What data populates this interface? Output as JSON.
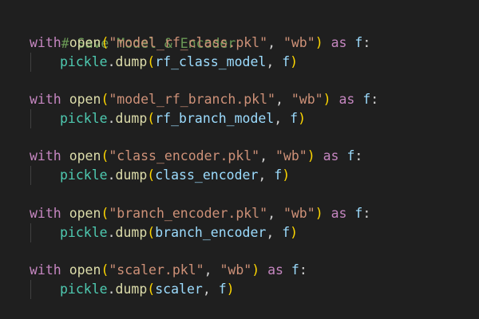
{
  "colors": {
    "background": "#1f1f1f",
    "comment": "#6a9955",
    "keyword": "#c586c0",
    "function": "#dcdcaa",
    "string": "#ce9178",
    "variable": "#9cdcfe",
    "module": "#4ec9b0",
    "bracket_level_1": "#ffd700",
    "bracket_level_2": "#da70d6"
  },
  "comment": "# Save Model & Encoder",
  "blocks": [
    {
      "with_kw": "with",
      "open_fn": "open",
      "filename": "\"model_rf_class.pkl\"",
      "mode": "\"wb\"",
      "as_kw": "as",
      "alias": "f",
      "module": "pickle",
      "method": "dump",
      "object": "rf_class_model",
      "target": "f"
    },
    {
      "with_kw": "with",
      "open_fn": "open",
      "filename": "\"model_rf_branch.pkl\"",
      "mode": "\"wb\"",
      "as_kw": "as",
      "alias": "f",
      "module": "pickle",
      "method": "dump",
      "object": "rf_branch_model",
      "target": "f"
    },
    {
      "with_kw": "with",
      "open_fn": "open",
      "filename": "\"class_encoder.pkl\"",
      "mode": "\"wb\"",
      "as_kw": "as",
      "alias": "f",
      "module": "pickle",
      "method": "dump",
      "object": "class_encoder",
      "target": "f"
    },
    {
      "with_kw": "with",
      "open_fn": "open",
      "filename": "\"branch_encoder.pkl\"",
      "mode": "\"wb\"",
      "as_kw": "as",
      "alias": "f",
      "module": "pickle",
      "method": "dump",
      "object": "branch_encoder",
      "target": "f"
    },
    {
      "with_kw": "with",
      "open_fn": "open",
      "filename": "\"scaler.pkl\"",
      "mode": "\"wb\"",
      "as_kw": "as",
      "alias": "f",
      "module": "pickle",
      "method": "dump",
      "object": "scaler",
      "target": "f"
    }
  ]
}
